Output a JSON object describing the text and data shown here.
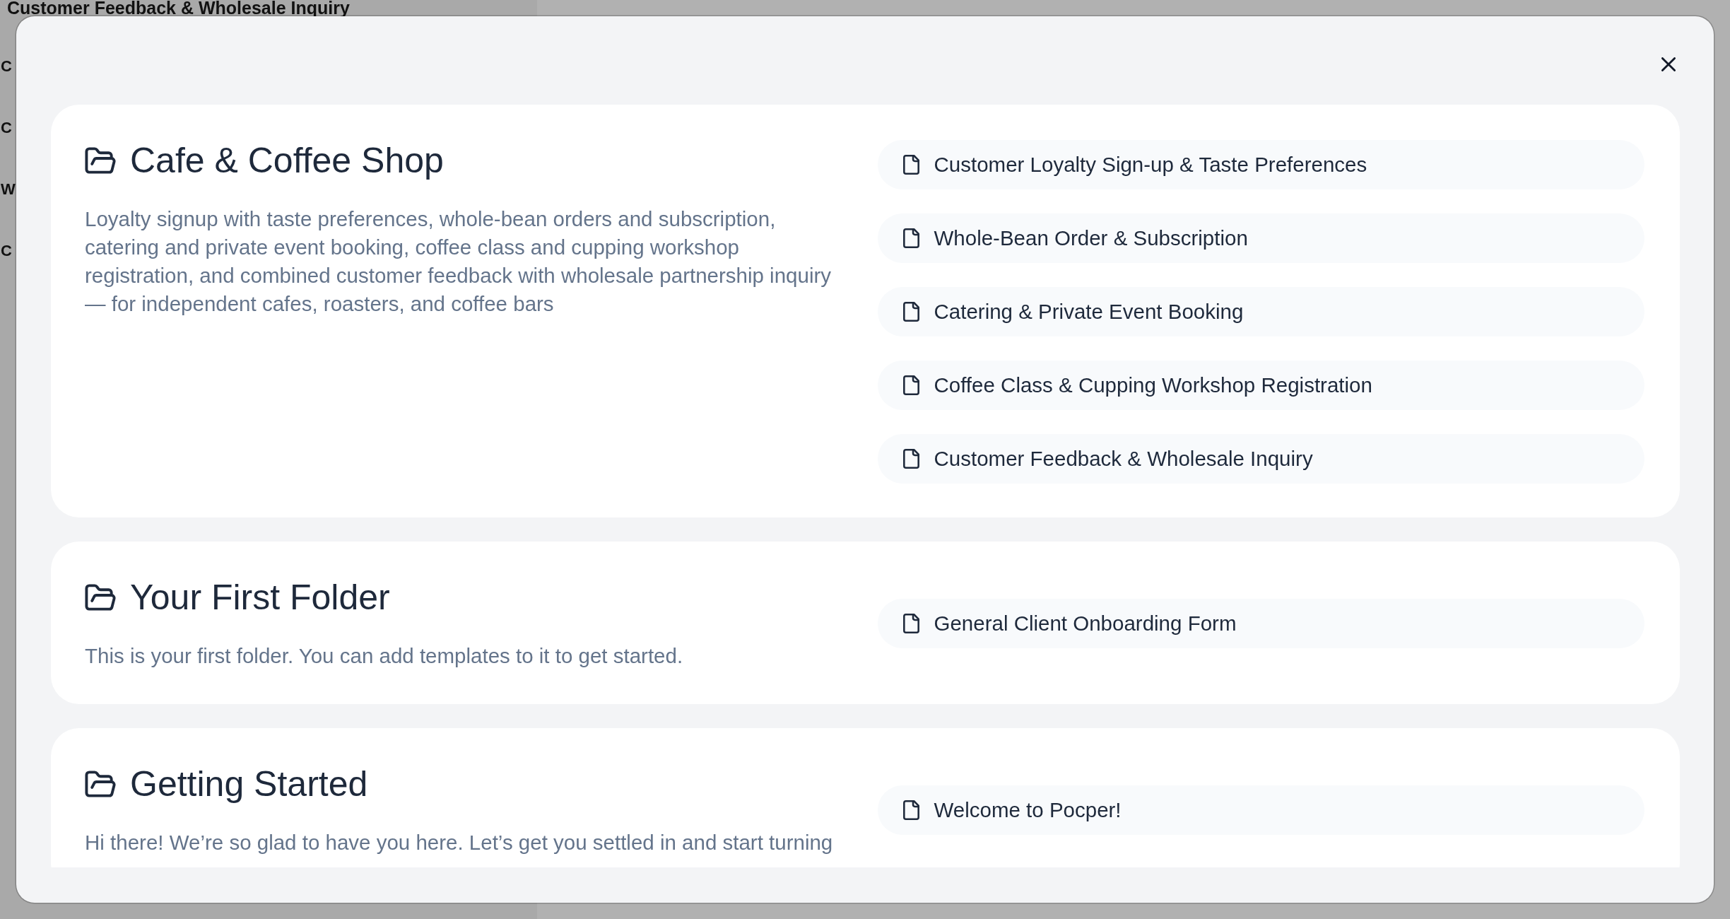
{
  "background_page": {
    "heading": "Customer Feedback & Wholesale Inquiry",
    "partial_lines": [
      "C",
      "C",
      "W",
      "C"
    ]
  },
  "folders": [
    {
      "title": "Cafe & Coffee Shop",
      "description": "Loyalty signup with taste preferences, whole-bean orders and subscription, catering and private event booking, coffee class and cupping workshop registration, and combined customer feedback with wholesale partnership inquiry — for independent cafes, roasters, and coffee bars",
      "templates": [
        "Customer Loyalty Sign-up & Taste Preferences",
        "Whole-Bean Order & Subscription",
        "Catering & Private Event Booking",
        "Coffee Class & Cupping Workshop Registration",
        "Customer Feedback & Wholesale Inquiry"
      ]
    },
    {
      "title": "Your First Folder",
      "description": "This is your first folder. You can add templates to it to get started.",
      "templates": [
        "General Client Onboarding Form"
      ]
    },
    {
      "title": "Getting Started",
      "description": "Hi there! We’re so glad to have you here. Let’s get you settled in and start turning",
      "templates": [
        "Welcome to Pocper!"
      ]
    }
  ]
}
